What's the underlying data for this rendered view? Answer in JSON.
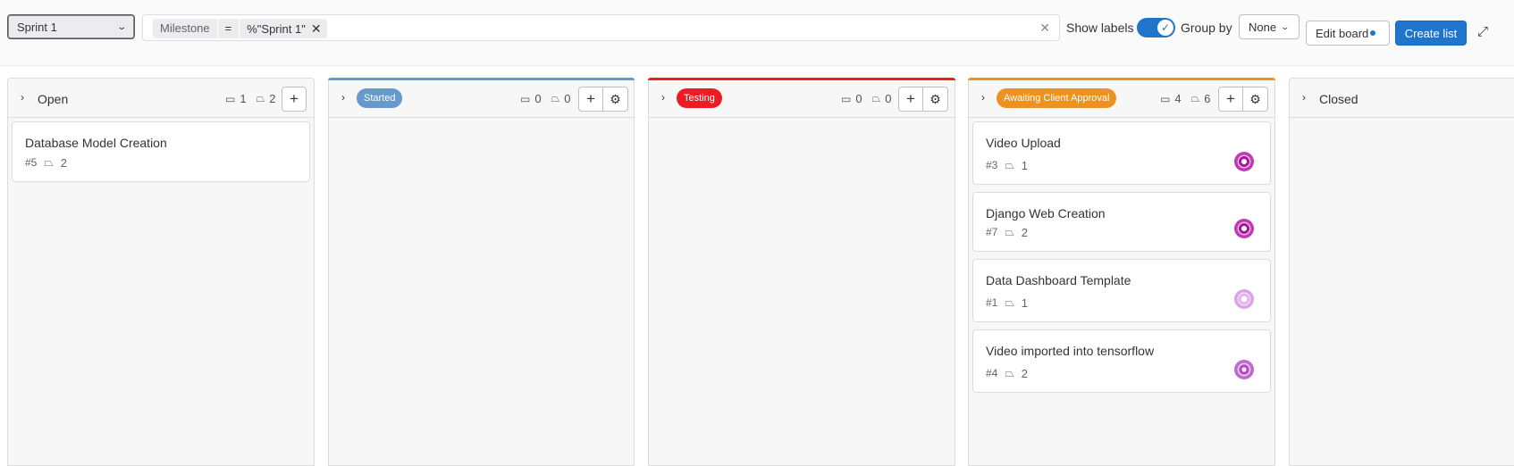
{
  "topbar": {
    "board_select": "Sprint 1",
    "filter": {
      "token_name": "Milestone",
      "token_operator": "=",
      "token_value": "%\"Sprint 1\"",
      "token_close": "✕",
      "clear": "✕"
    },
    "show_labels": "Show labels",
    "show_labels_on": true,
    "group_by_label": "Group by",
    "group_by_value": "None",
    "edit_board": "Edit board",
    "create_list": "Create list"
  },
  "lists": [
    {
      "title": "Open",
      "issues_count": "1",
      "weight": "2",
      "cards": [
        {
          "title": "Database Model Creation",
          "id": "#5",
          "weight": "2"
        }
      ]
    },
    {
      "label": "Started",
      "label_color": "#6699cc",
      "issues_count": "0",
      "weight": "0",
      "cards": []
    },
    {
      "label": "Testing",
      "label_color": "#ed1c24",
      "issues_count": "0",
      "weight": "0",
      "cards": []
    },
    {
      "label": "Awaiting Client Approval",
      "label_color": "#ed9121",
      "issues_count": "4",
      "weight": "6",
      "cards": [
        {
          "title": "Video Upload",
          "id": "#3",
          "weight": "1"
        },
        {
          "title": "Django Web Creation",
          "id": "#7",
          "weight": "2"
        },
        {
          "title": "Data Dashboard Template",
          "id": "#1",
          "weight": "1"
        },
        {
          "title": "Video imported into tensorflow",
          "id": "#4",
          "weight": "2"
        }
      ]
    },
    {
      "title": "Closed",
      "cards": []
    }
  ],
  "colors": {
    "accent": "#1f75cb",
    "avatar_dark": "#a51d9c",
    "avatar_light": "#d9a3e6"
  }
}
